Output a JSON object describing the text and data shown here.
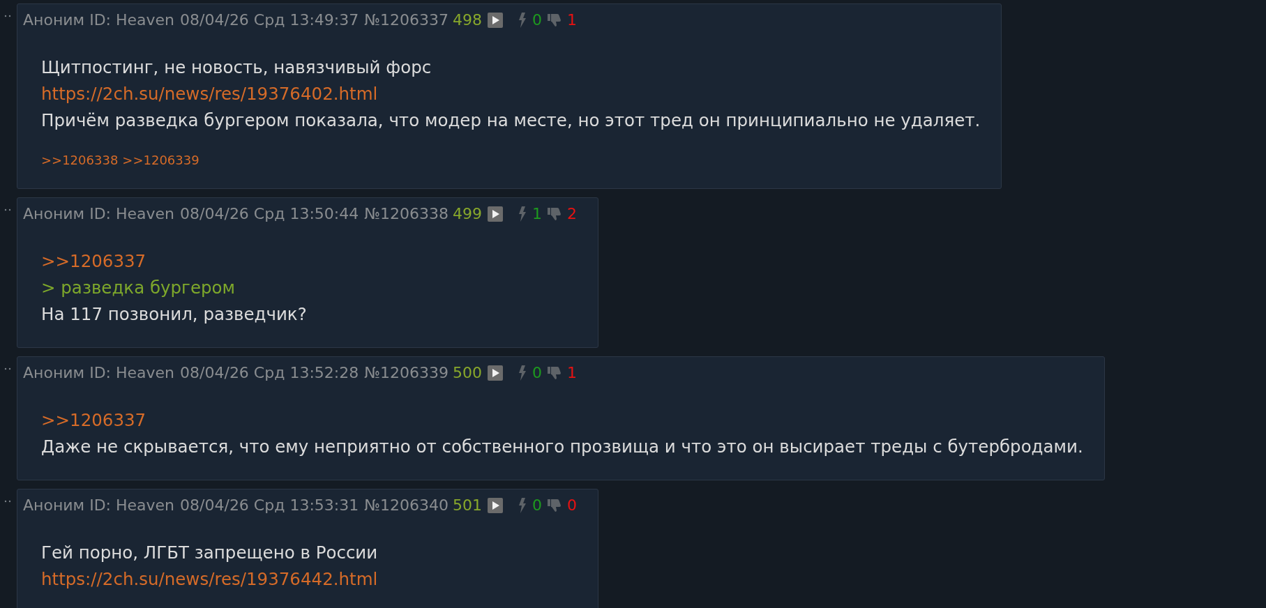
{
  "posts": [
    {
      "author": "Аноним ID: Heaven",
      "date": "08/04/26 Срд 13:49:37",
      "number": "№1206337",
      "count": "498",
      "likes_text": "0",
      "dislikes": "1",
      "lines": [
        {
          "kind": "text",
          "text": "Щитпостинг, не новость, навязчивый форс"
        },
        {
          "kind": "link",
          "text": "https://2ch.su/news/res/19376402.html"
        },
        {
          "kind": "text",
          "text": "Причём разведка бургером показала, что модер на месте, но этот тред он принципиально не удаляет."
        }
      ],
      "replies": [
        ">>1206338",
        ">>1206339"
      ]
    },
    {
      "author": "Аноним ID: Heaven",
      "date": "08/04/26 Срд 13:50:44",
      "number": "№1206338",
      "count": "499",
      "likes_text": "1",
      "dislikes": "2",
      "lines": [
        {
          "kind": "link",
          "text": ">>1206337"
        },
        {
          "kind": "quote",
          "text": "> разведка бургером"
        },
        {
          "kind": "text",
          "text": "На 117 позвонил, разведчик?"
        }
      ]
    },
    {
      "author": "Аноним ID: Heaven",
      "date": "08/04/26 Срд 13:52:28",
      "number": "№1206339",
      "count": "500",
      "likes_text": "0",
      "dislikes": "1",
      "lines": [
        {
          "kind": "link",
          "text": ">>1206337"
        },
        {
          "kind": "text",
          "text": "Даже не скрывается, что ему неприятно от собственного прозвища и что это он высирает треды с бутербродами."
        }
      ]
    },
    {
      "author": "Аноним ID: Heaven",
      "date": "08/04/26 Срд 13:53:31",
      "number": "№1206340",
      "count": "501",
      "likes_text": "0",
      "dislikes": "0",
      "lines": [
        {
          "kind": "text",
          "text": "Гей порно, ЛГБТ запрещено в России"
        },
        {
          "kind": "link",
          "text": "https://2ch.su/news/res/19376442.html"
        }
      ]
    }
  ]
}
